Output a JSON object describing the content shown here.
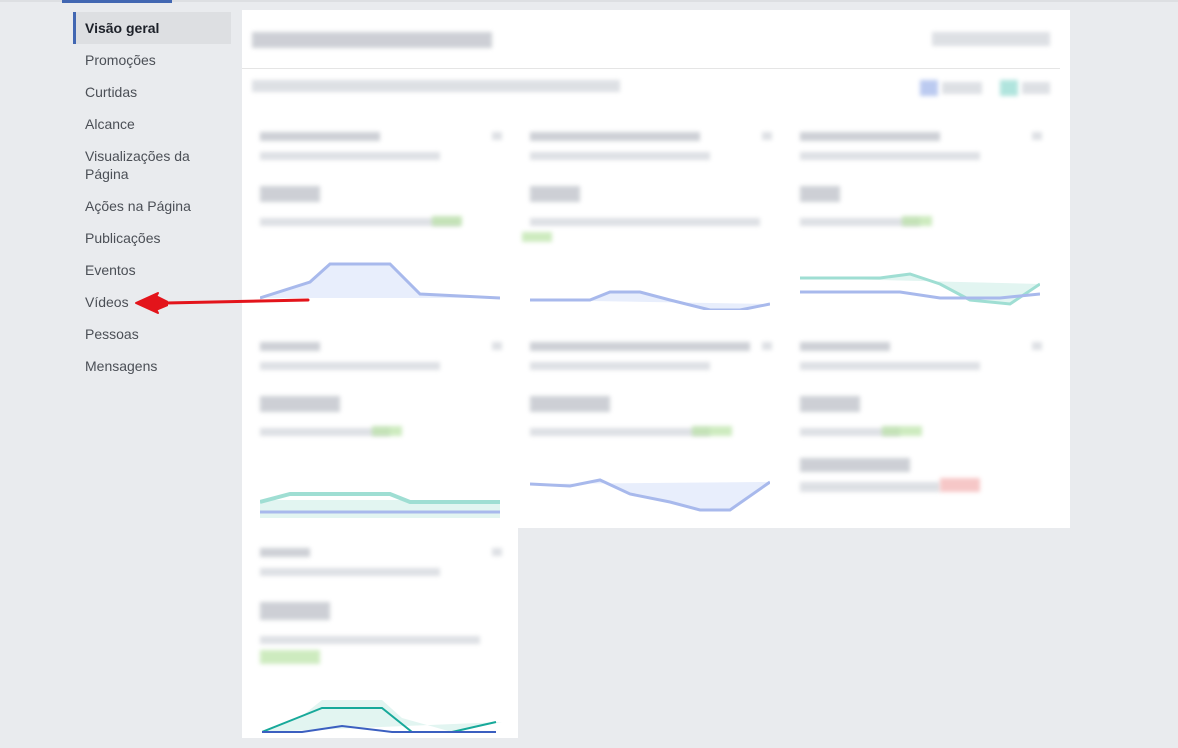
{
  "sidebar": {
    "items": [
      {
        "label": "Visão geral",
        "active": true
      },
      {
        "label": "Promoções"
      },
      {
        "label": "Curtidas"
      },
      {
        "label": "Alcance"
      },
      {
        "label": "Visualizações da Página"
      },
      {
        "label": "Ações na Página"
      },
      {
        "label": "Publicações"
      },
      {
        "label": "Eventos"
      },
      {
        "label": "Vídeos"
      },
      {
        "label": "Pessoas"
      },
      {
        "label": "Mensagens"
      }
    ]
  },
  "colors": {
    "accent": "#4267b2",
    "annotation_arrow": "#e3141b",
    "background": "#e9ebee"
  },
  "annotation": {
    "target": "sidebar-item-videos",
    "icon": "red-arrow-icon"
  }
}
